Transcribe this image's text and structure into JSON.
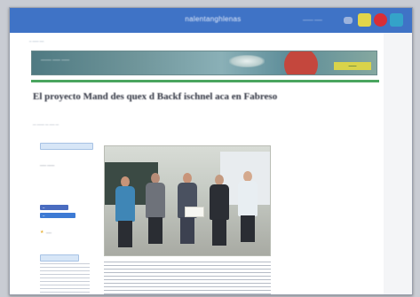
{
  "header": {
    "logo": "nalentanghlenas",
    "nav_text": "ــــــ ــــــــ",
    "social": [
      {
        "name": "misc-icon"
      },
      {
        "name": "yellow-social-icon",
        "color": "#e2d54a"
      },
      {
        "name": "red-social-icon",
        "color": "#d92e36"
      },
      {
        "name": "teal-social-icon",
        "color": "#34a3c9"
      }
    ]
  },
  "breadcrumb": "ــــ ــــــ ــ",
  "banner": {
    "text": "ــــــ ــــــ ــــــــ",
    "brand": "ـــــ"
  },
  "article": {
    "headline": "El proyecto Mand des quex d Backf ischnel aca en Fabreso",
    "byline": "ـــ ـــــ ـــ ـــــــ ـــ",
    "accent_color": "#4aa55f"
  },
  "sidebar": {
    "chip1": "",
    "label1": "ـــــــ ــــــ",
    "fb_label": "ــ",
    "tw_label": "ــ",
    "star_label": "ـــــ",
    "chip2": ""
  }
}
